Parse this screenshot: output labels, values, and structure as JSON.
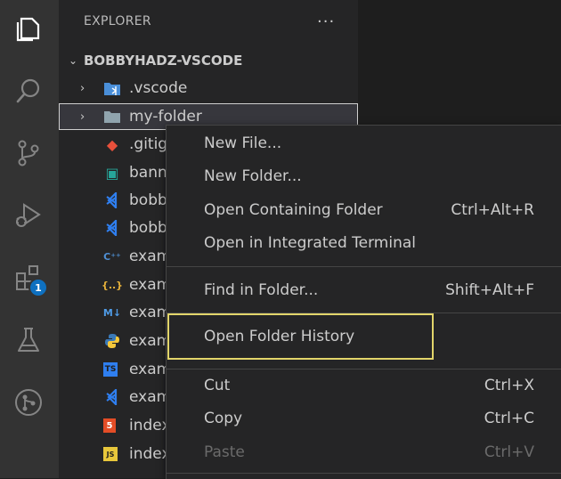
{
  "sidebar": {
    "header": "EXPLORER",
    "more": "···",
    "workspace": "BOBBYHADZ-VSCODE",
    "items": [
      {
        "name": ".vscode",
        "chev": "›",
        "icon": "vscode-folder-icon",
        "type": "folder"
      },
      {
        "name": "my-folder",
        "chev": "›",
        "icon": "folder-icon",
        "type": "folder"
      },
      {
        "name": ".gitig",
        "icon": "git-icon",
        "glyph": "◆",
        "color": "#e8503b"
      },
      {
        "name": "bann",
        "icon": "image-icon",
        "glyph": "▣",
        "color": "#26a69a"
      },
      {
        "name": "bobb",
        "icon": "vscode-file-icon",
        "glyph": "⟩",
        "color": "#2f7ff0"
      },
      {
        "name": "bobb",
        "icon": "vscode-file-icon",
        "glyph": "⟩",
        "color": "#2f7ff0"
      },
      {
        "name": "exam",
        "icon": "cpp-icon",
        "glyph": "C⁺⁺",
        "color": "#4f8fd4"
      },
      {
        "name": "exam",
        "icon": "json-icon",
        "glyph": "{..}",
        "color": "#e7b23b"
      },
      {
        "name": "exam",
        "icon": "markdown-icon",
        "glyph": "M↓",
        "color": "#4f9be6"
      },
      {
        "name": "exam",
        "icon": "python-icon",
        "glyph": "●",
        "color": "#3a79b7"
      },
      {
        "name": "exam",
        "icon": "typescript-icon",
        "glyph": "TS",
        "color": "#2f7ff0"
      },
      {
        "name": "exam",
        "icon": "vscode-file-icon",
        "glyph": "⟩",
        "color": "#2f7ff0"
      },
      {
        "name": "index",
        "icon": "html-icon",
        "glyph": "5",
        "color": "#e44d26"
      },
      {
        "name": "index",
        "icon": "javascript-icon",
        "glyph": "JS",
        "color": "#e8c73b"
      }
    ]
  },
  "activity_bar": {
    "extensions_badge": "1"
  },
  "context_menu": {
    "items": [
      {
        "label": "New File...",
        "shortcut": ""
      },
      {
        "label": "New Folder...",
        "shortcut": ""
      },
      {
        "label": "Open Containing Folder",
        "shortcut": "Ctrl+Alt+R"
      },
      {
        "label": "Open in Integrated Terminal",
        "shortcut": ""
      },
      {
        "label": "Find in Folder...",
        "shortcut": "Shift+Alt+F"
      },
      {
        "label": "Open Folder History",
        "shortcut": ""
      },
      {
        "label": "Cut",
        "shortcut": "Ctrl+X"
      },
      {
        "label": "Copy",
        "shortcut": "Ctrl+C"
      },
      {
        "label": "Paste",
        "shortcut": "Ctrl+V"
      }
    ]
  },
  "colors": {
    "highlight": "#e2d56a",
    "badge": "#0e70c0"
  }
}
